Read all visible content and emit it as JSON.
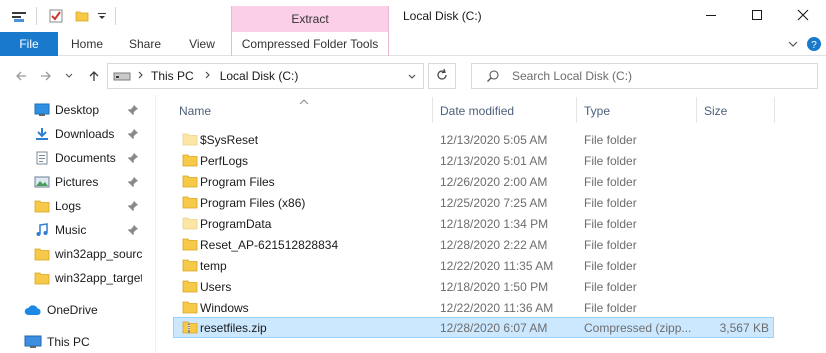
{
  "colors": {
    "file_tab": "#1979ca",
    "context_tab": "#fbcfe8",
    "selected_row": "#cce8ff",
    "folder": "#f7c948"
  },
  "titlebar": {
    "context_group": "Extract",
    "title": "Local Disk (C:)",
    "qat_icons": [
      "quick-access-properties-icon",
      "checkmark-icon",
      "folder-icon",
      "customize-dropdown-icon"
    ],
    "buttons": [
      "minimize-icon",
      "maximize-icon",
      "close-icon"
    ]
  },
  "ribbon": {
    "tabs": [
      "File",
      "Home",
      "Share",
      "View"
    ],
    "context_tab": "Compressed Folder Tools",
    "controls": [
      "expand-ribbon-icon",
      "help-icon"
    ]
  },
  "addressbar": {
    "crumbs": [
      "This PC",
      "Local Disk (C:)"
    ],
    "search_placeholder": "Search Local Disk (C:)"
  },
  "navpane": {
    "quick_access": [
      {
        "label": "Desktop",
        "icon": "desktop-icon",
        "pinned": true
      },
      {
        "label": "Downloads",
        "icon": "download-icon",
        "pinned": true
      },
      {
        "label": "Documents",
        "icon": "documents-icon",
        "pinned": true
      },
      {
        "label": "Pictures",
        "icon": "pictures-icon",
        "pinned": true
      },
      {
        "label": "Logs",
        "icon": "folder-icon",
        "pinned": true
      },
      {
        "label": "Music",
        "icon": "music-icon",
        "pinned": true
      },
      {
        "label": "win32app_sourc",
        "icon": "folder-icon",
        "pinned": false
      },
      {
        "label": "win32app_target",
        "icon": "folder-icon",
        "pinned": false
      }
    ],
    "onedrive": "OneDrive",
    "thispc": "This PC"
  },
  "list": {
    "columns": {
      "name": "Name",
      "date": "Date modified",
      "type": "Type",
      "size": "Size"
    },
    "rows": [
      {
        "name": "$SysReset",
        "date": "12/13/2020 5:05 AM",
        "type": "File folder",
        "size": "",
        "icon": "folder-faded-icon"
      },
      {
        "name": "PerfLogs",
        "date": "12/13/2020 5:01 AM",
        "type": "File folder",
        "size": "",
        "icon": "folder-icon"
      },
      {
        "name": "Program Files",
        "date": "12/26/2020 2:00 AM",
        "type": "File folder",
        "size": "",
        "icon": "folder-icon"
      },
      {
        "name": "Program Files (x86)",
        "date": "12/25/2020 7:25 AM",
        "type": "File folder",
        "size": "",
        "icon": "folder-icon"
      },
      {
        "name": "ProgramData",
        "date": "12/18/2020 1:34 PM",
        "type": "File folder",
        "size": "",
        "icon": "folder-faded-icon"
      },
      {
        "name": "Reset_AP-621512828834",
        "date": "12/28/2020 2:22 AM",
        "type": "File folder",
        "size": "",
        "icon": "folder-icon"
      },
      {
        "name": "temp",
        "date": "12/22/2020 11:35 AM",
        "type": "File folder",
        "size": "",
        "icon": "folder-icon"
      },
      {
        "name": "Users",
        "date": "12/18/2020 1:50 PM",
        "type": "File folder",
        "size": "",
        "icon": "folder-icon"
      },
      {
        "name": "Windows",
        "date": "12/22/2020 11:36 AM",
        "type": "File folder",
        "size": "",
        "icon": "folder-icon"
      },
      {
        "name": "resetfiles.zip",
        "date": "12/28/2020 6:07 AM",
        "type": "Compressed (zipp...",
        "size": "3,567 KB",
        "icon": "zip-file-icon",
        "selected": true
      }
    ]
  }
}
